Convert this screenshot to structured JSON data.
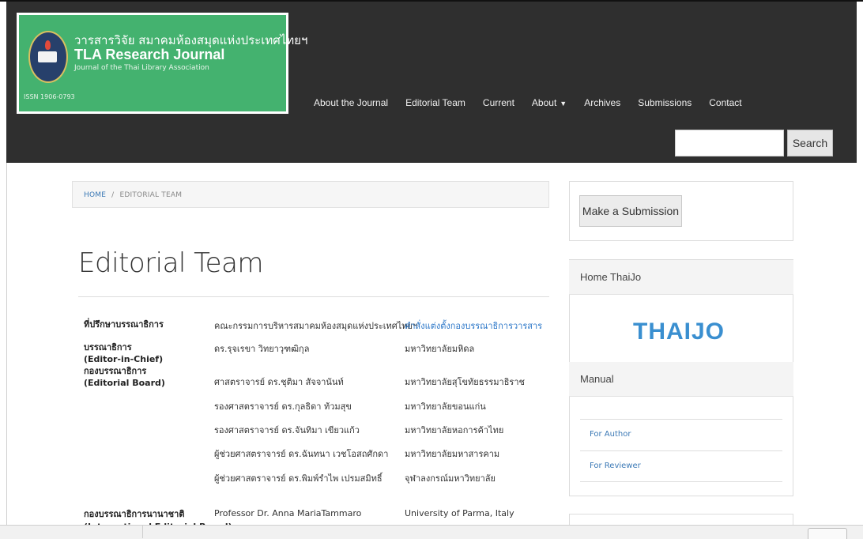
{
  "site": {
    "thai_title": "วารสารวิจัย สมาคมห้องสมุดแห่งประเทศไทยฯ",
    "title": "TLA Research Journal",
    "subtitle": "Journal of the Thai Library Association",
    "issn": "ISSN 1906-0793"
  },
  "nav": {
    "items": [
      {
        "label": "About the Journal"
      },
      {
        "label": "Editorial Team"
      },
      {
        "label": "Current"
      },
      {
        "label": "About"
      },
      {
        "label": "Archives"
      },
      {
        "label": "Submissions"
      },
      {
        "label": "Contact"
      }
    ]
  },
  "search": {
    "placeholder": "",
    "button": "Search"
  },
  "breadcrumb": {
    "home": "HOME",
    "separator": "/",
    "current": "EDITORIAL TEAM"
  },
  "page_title": "Editorial Team",
  "roles": {
    "advisor": "ที่ปรึกษาบรรณาธิการ",
    "editor_th": "บรรณาธิการ",
    "editor_en": "(Editor-in-Chief)",
    "board_th": "กองบรรณาธิการ",
    "board_en": "(Editorial Board)",
    "intl_th": "กองบรรณาธิการนานาชาติ",
    "intl_en": "(International Editorial Board)"
  },
  "members": [
    {
      "name": "คณะกรรมการบริหารสมาคมห้องสมุดแห่งประเทศไทยฯ",
      "affil": "คำสั่งแต่งตั้งกองบรรณาธิการวารสาร"
    },
    {
      "name": "ดร.รุจเรขา วิทยาวุฑฒิกุล",
      "affil": "มหาวิทยาลัยมหิดล"
    },
    {
      "name": "ศาสตราจารย์ ดร.ชุติมา สัจจานันท์",
      "affil": "มหาวิทยาลัยสุโขทัยธรรมาธิราช"
    },
    {
      "name": "รองศาสตราจารย์ ดร.กุลธิดา ท้วมสุข",
      "affil": "มหาวิทยาลัยขอนแก่น"
    },
    {
      "name": "รองศาสตราจารย์ ดร.จันทิมา เขียวแก้ว",
      "affil": "มหาวิทยาลัยหอการค้าไทย"
    },
    {
      "name": "ผู้ช่วยศาสตราจารย์ ดร.ฉันทนา เวชโอสถศักดา",
      "affil": "มหาวิทยาลัยมหาสารคาม"
    },
    {
      "name": "ผู้ช่วยศาสตราจารย์ ดร.พิมพ์รำไพ เปรมสมิทธิ์",
      "affil": "จุฬาลงกรณ์มหาวิทยาลัย"
    },
    {
      "name": "Professor Dr. Anna MariaTammaro",
      "affil": "University of Parma, Italy"
    }
  ],
  "sidebar": {
    "submit": "Make a Submission",
    "home_thaijo": "Home ThaiJo",
    "thaijo_logo": "THAIJO",
    "manual": "Manual",
    "for_author": "For Author",
    "for_reviewer": "For Reviewer"
  },
  "colors": {
    "header": "#2f2f2f",
    "logo_green": "#44b26f",
    "link": "#2a76c8",
    "thaijo": "#3a8fd0"
  }
}
